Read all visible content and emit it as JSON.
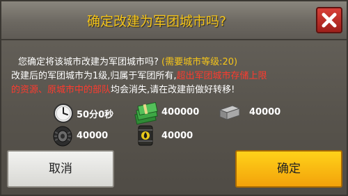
{
  "dialog": {
    "title": "确定改建为军团城市吗?",
    "close_label": "✕",
    "message": {
      "line1_text": "您确定将该城市改建为军团城市吗?",
      "line1_requirement": "(需要城市等级:20)",
      "line2_text": "改建后的军团城市为1级,归属于军团所有,",
      "line2_warning": "超出军团城市存储上限",
      "line3_warning": "的资源、原城市中的部队",
      "line3_text": "均会消失,请在改建前做好转移!"
    },
    "costs": {
      "time": {
        "icon": "clock-icon",
        "value": "50分0秒"
      },
      "cash": {
        "icon": "cash-icon",
        "value": "400000"
      },
      "steel": {
        "icon": "steel-icon",
        "value": "40000"
      },
      "rubber": {
        "icon": "tire-icon",
        "value": "40000"
      },
      "oil": {
        "icon": "oil-barrel-icon",
        "value": "40000"
      }
    },
    "buttons": {
      "cancel_label": "取消",
      "confirm_label": "确定"
    }
  },
  "colors": {
    "title": "#f5c51a",
    "warning": "#ff3a2e",
    "confirm_button": "#f3a20a",
    "close_button": "#c0302a"
  }
}
